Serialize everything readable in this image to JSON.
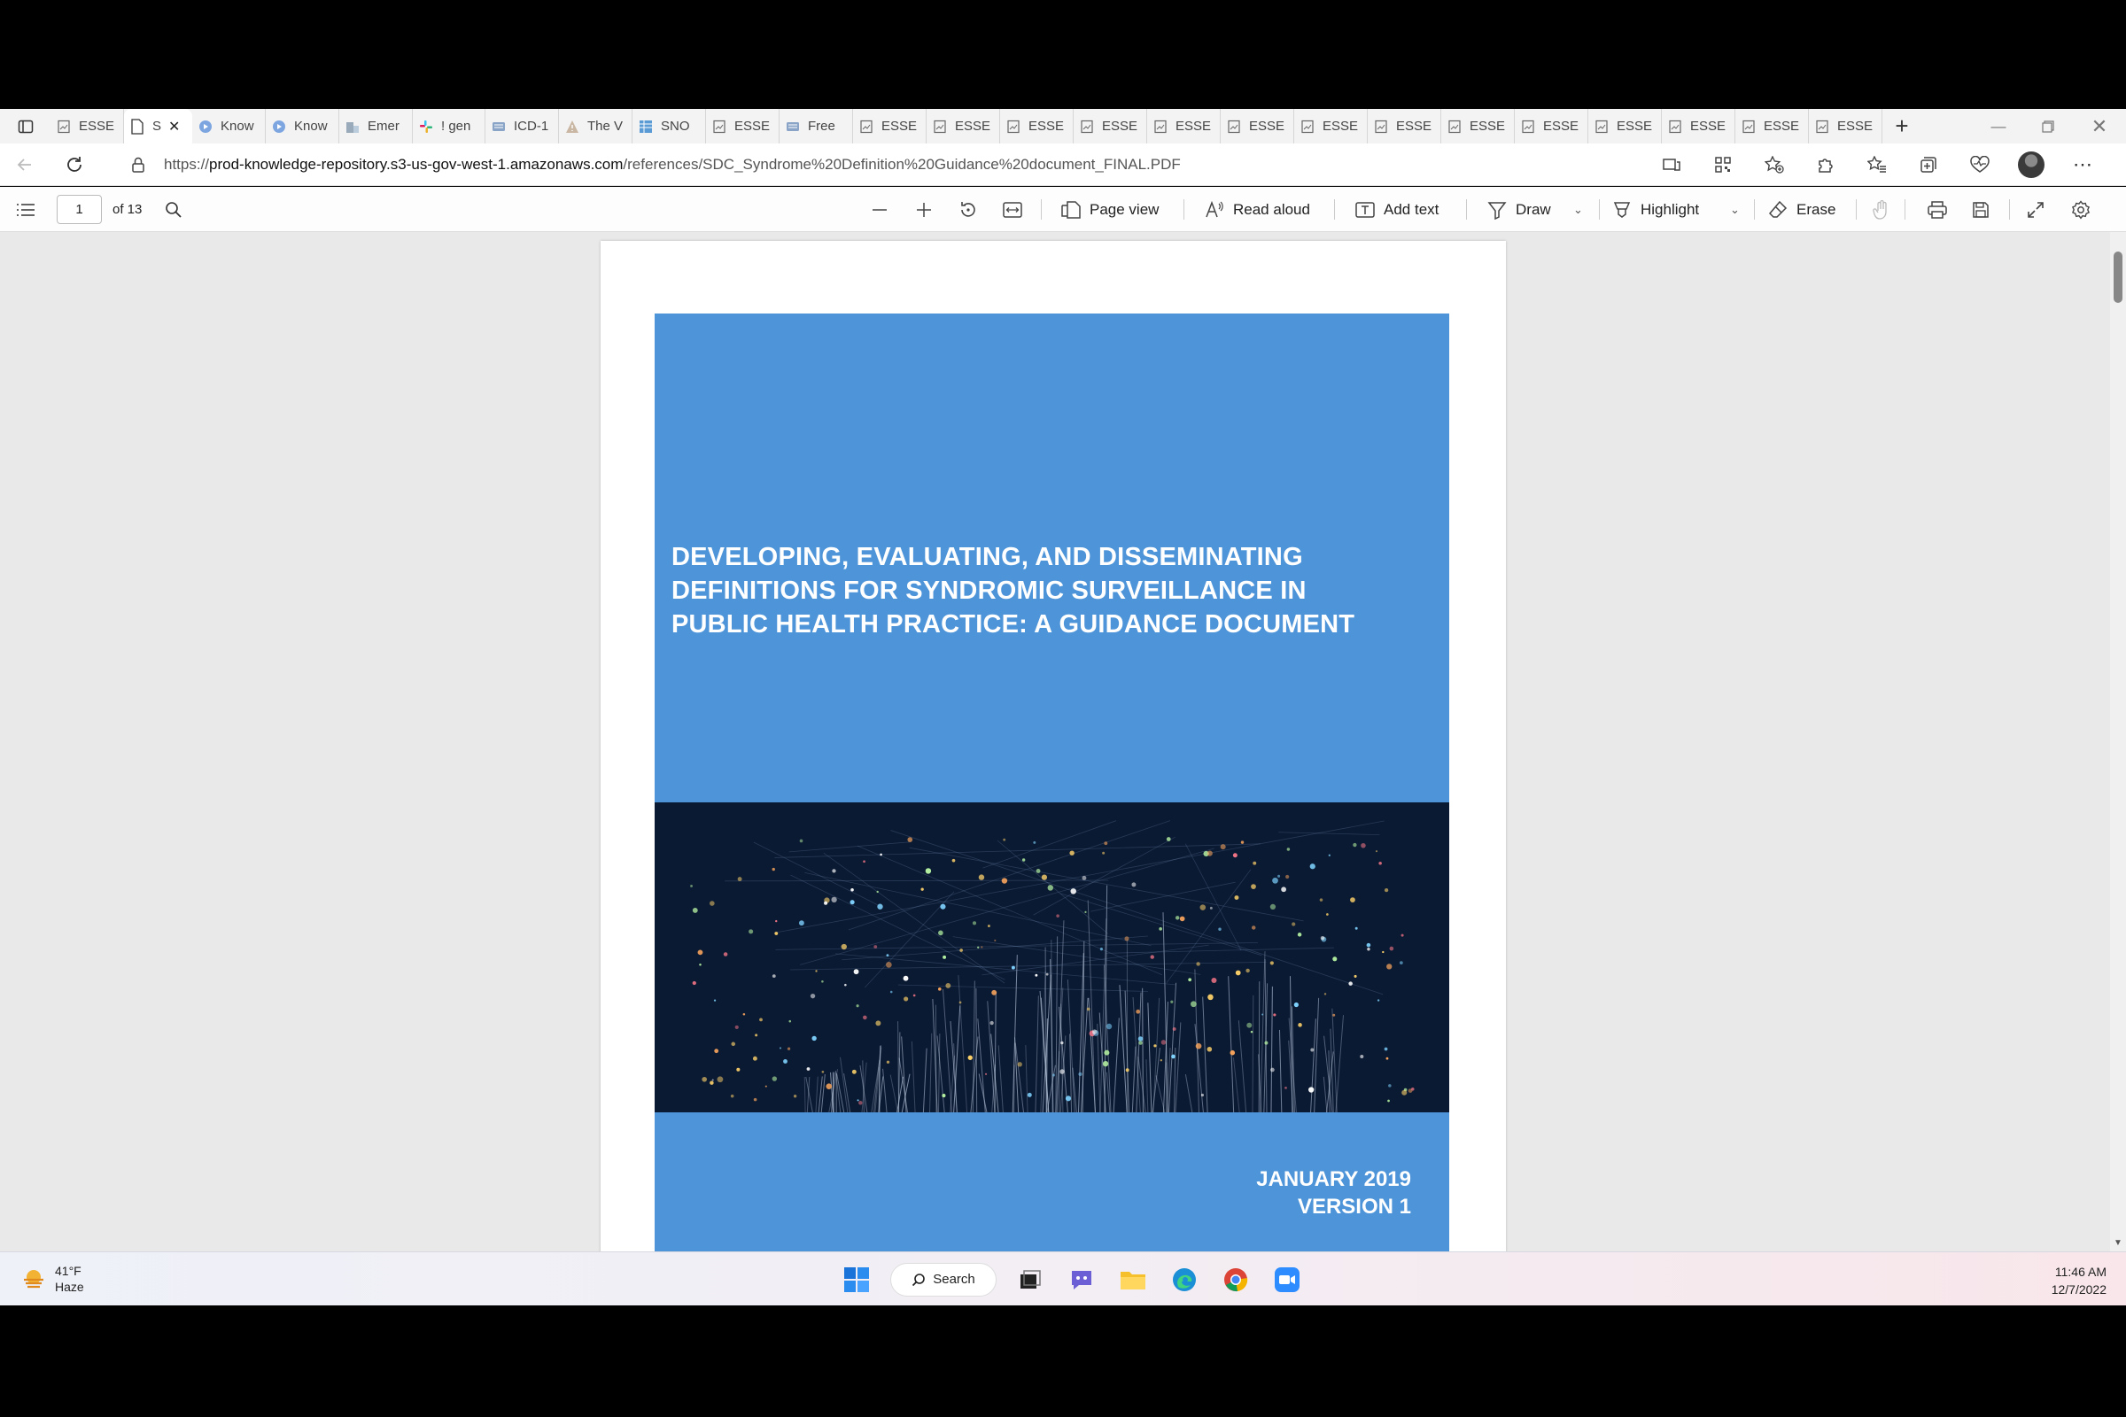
{
  "browser": {
    "tabs": [
      {
        "title": "ESSE",
        "icon": "document-icon",
        "active": false
      },
      {
        "title": "S",
        "icon": "pdf-icon",
        "active": true
      },
      {
        "title": "Know",
        "icon": "play-circle-icon",
        "active": false
      },
      {
        "title": "Know",
        "icon": "play-circle-icon",
        "active": false
      },
      {
        "title": "Emer",
        "icon": "building-icon",
        "active": false
      },
      {
        "title": "! gen",
        "icon": "slack-icon",
        "active": false
      },
      {
        "title": "ICD-1",
        "icon": "keyboard-icon",
        "active": false
      },
      {
        "title": "The V",
        "icon": "warning-icon",
        "active": false
      },
      {
        "title": "SNO",
        "icon": "table-icon",
        "active": false
      },
      {
        "title": "ESSE",
        "icon": "document-icon",
        "active": false
      },
      {
        "title": "Free",
        "icon": "keyboard-icon",
        "active": false
      },
      {
        "title": "ESSE",
        "icon": "document-icon",
        "active": false
      },
      {
        "title": "ESSE",
        "icon": "document-icon",
        "active": false
      },
      {
        "title": "ESSE",
        "icon": "document-icon",
        "active": false
      },
      {
        "title": "ESSE",
        "icon": "document-icon",
        "active": false
      },
      {
        "title": "ESSE",
        "icon": "document-icon",
        "active": false
      },
      {
        "title": "ESSE",
        "icon": "document-icon",
        "active": false
      },
      {
        "title": "ESSE",
        "icon": "document-icon",
        "active": false
      },
      {
        "title": "ESSE",
        "icon": "document-icon",
        "active": false
      },
      {
        "title": "ESSE",
        "icon": "document-icon",
        "active": false
      },
      {
        "title": "ESSE",
        "icon": "document-icon",
        "active": false
      },
      {
        "title": "ESSE",
        "icon": "document-icon",
        "active": false
      },
      {
        "title": "ESSE",
        "icon": "document-icon",
        "active": false
      },
      {
        "title": "ESSE",
        "icon": "document-icon",
        "active": false
      },
      {
        "title": "ESSE",
        "icon": "document-icon",
        "active": false
      }
    ],
    "url_prefix": "https://",
    "url_host": "prod-knowledge-repository.s3-us-gov-west-1.amazonaws.com",
    "url_path": "/references/SDC_Syndrome%20Definition%20Guidance%20document_FINAL.PDF"
  },
  "pdf_toolbar": {
    "page_number": "1",
    "page_total": "of 13",
    "page_view": "Page view",
    "read_aloud": "Read aloud",
    "add_text": "Add text",
    "draw": "Draw",
    "highlight": "Highlight",
    "erase": "Erase"
  },
  "document": {
    "title_lines": [
      "DEVELOPING, EVALUATING, AND DISSEMINATING",
      "DEFINITIONS FOR SYNDROMIC SURVEILLANCE IN",
      "PUBLIC HEALTH PRACTICE: A GUIDANCE DOCUMENT"
    ],
    "date": "JANUARY 2019",
    "version": "VERSION 1"
  },
  "taskbar": {
    "weather_temp": "41°F",
    "weather_desc": "Haze",
    "search_label": "Search",
    "time": "11:46 AM",
    "date": "12/7/2022"
  },
  "colors": {
    "cover_blue": "#4e94d9",
    "cover_dark": "#0b1a33"
  }
}
